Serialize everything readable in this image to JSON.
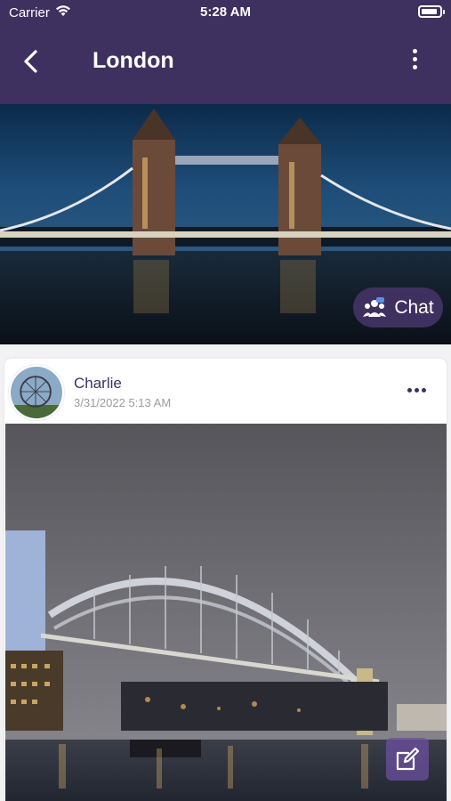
{
  "status_bar": {
    "carrier": "Carrier",
    "time": "5:28 AM"
  },
  "header": {
    "title": "London",
    "back_icon": "chevron-left-icon",
    "more_icon": "vertical-ellipsis-icon"
  },
  "hero": {
    "image": "tower-bridge-night-photo",
    "chat_label": "Chat",
    "chat_icon": "group-chat-icon"
  },
  "post": {
    "author": "Charlie",
    "timestamp": "3/31/2022 5:13 AM",
    "more_icon": "horizontal-ellipsis-icon",
    "avatar": "london-eye-photo",
    "image": "sydney-harbour-bridge-night-photo"
  },
  "fab": {
    "icon": "edit-icon"
  },
  "colors": {
    "brand": "#3e3160",
    "background": "#f2f2f4",
    "muted_text": "#9b9b9b"
  }
}
